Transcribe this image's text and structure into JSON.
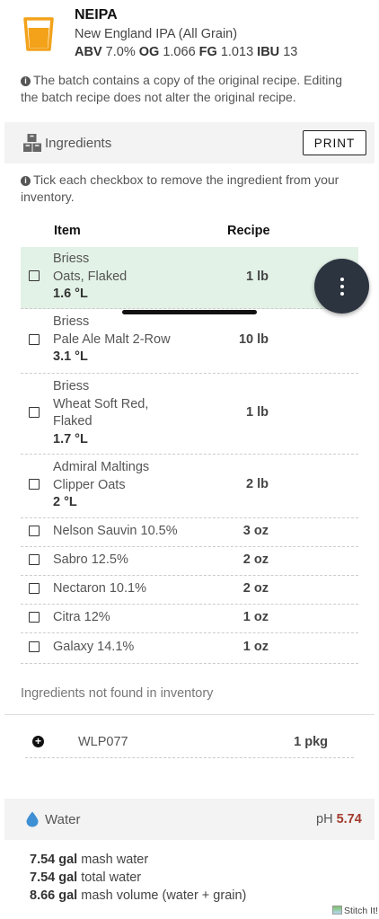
{
  "recipe": {
    "name": "NEIPA",
    "style": "New England IPA (All Grain)",
    "stats": [
      {
        "label": "ABV",
        "value": "7.0%"
      },
      {
        "label": "OG",
        "value": "1.066"
      },
      {
        "label": "FG",
        "value": "1.013"
      },
      {
        "label": "IBU",
        "value": "13"
      }
    ]
  },
  "copy_note": "The batch contains a copy of the original recipe. Editing the batch recipe does not alter the original recipe.",
  "ingredients": {
    "title": "Ingredients",
    "print_label": "PRINT",
    "note": "Tick each checkbox to remove the ingredient from your inventory.",
    "col_item": "Item",
    "col_recipe": "Recipe",
    "items": [
      {
        "supplier": "Briess",
        "name": "Oats, Flaked",
        "color": "1.6 °L",
        "amount": "1 lb",
        "selected": true
      },
      {
        "supplier": "Briess",
        "name": "Pale Ale Malt 2-Row",
        "color": "3.1 °L",
        "amount": "10 lb"
      },
      {
        "supplier": "Briess",
        "name": "Wheat Soft Red,",
        "name2": "Flaked",
        "color": "1.7 °L",
        "amount": "1 lb"
      },
      {
        "supplier": "Admiral Maltings",
        "name": "Clipper Oats",
        "color": "2 °L",
        "amount": "2 lb"
      },
      {
        "name": "Nelson Sauvin 10.5%",
        "amount": "3 oz"
      },
      {
        "name": "Sabro 12.5%",
        "amount": "2 oz"
      },
      {
        "name": "Nectaron 10.1%",
        "amount": "2 oz"
      },
      {
        "name": "Citra 12%",
        "amount": "1 oz"
      },
      {
        "name": "Galaxy 14.1%",
        "amount": "1 oz"
      }
    ],
    "not_found_label": "Ingredients not found in inventory",
    "not_found": [
      {
        "name": "WLP077",
        "amount": "1 pkg"
      }
    ]
  },
  "water": {
    "title": "Water",
    "ph_label": "pH",
    "ph_value": "5.74",
    "lines": [
      {
        "value": "7.54 gal",
        "label": "mash water"
      },
      {
        "value": "7.54 gal",
        "label": "total water"
      },
      {
        "value": "8.66 gal",
        "label": "mash volume (water + grain)"
      }
    ]
  },
  "footer": {
    "stitch_label": "Stitch It!"
  },
  "colors": {
    "selected_row": "#e3f2e7",
    "ph_value": "#a33a2e",
    "fab": "#2c3440",
    "water_drop": "#3f8fd4",
    "beer_glass": "#f3a21a"
  }
}
